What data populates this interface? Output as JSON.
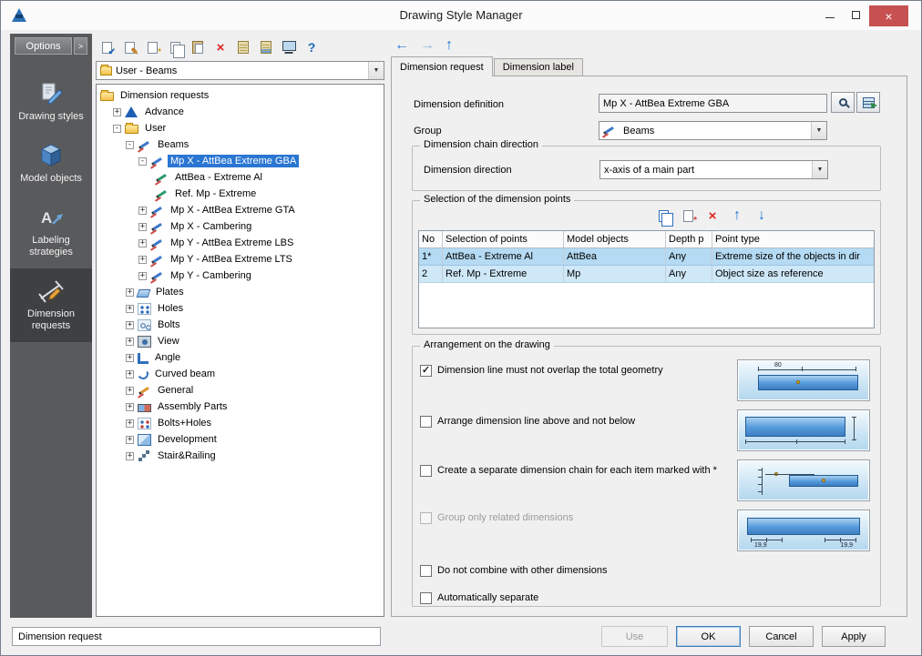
{
  "window": {
    "title": "Drawing Style Manager"
  },
  "colors": {
    "accent_blue": "#2a76d2",
    "sidebar_gray": "#595a5c",
    "row_selected_blue": "#b5daf3",
    "close_red": "#c75050"
  },
  "icons": {
    "close": "×",
    "check": "✔",
    "pencil": "✎",
    "star": "*",
    "cross": "×",
    "back": "←",
    "forward": "→",
    "up": "↑",
    "down": "↓",
    "help": "?",
    "dropdown": "▼",
    "chevron": ">",
    "checkmark": "✓",
    "arrow_small": "▶"
  },
  "sidebar": {
    "options_label": "Options",
    "items": [
      {
        "label": "Drawing styles",
        "selected": false
      },
      {
        "label": "Model objects",
        "selected": false
      },
      {
        "label": "Labeling strategies",
        "selected": false
      },
      {
        "label": "Dimension requests",
        "selected": true
      }
    ]
  },
  "tree": {
    "filter_value": "User - Beams",
    "items": [
      {
        "label": "Dimension requests",
        "depth": 0,
        "exp": ""
      },
      {
        "label": "Advance",
        "depth": 1,
        "exp": "+"
      },
      {
        "label": "User",
        "depth": 1,
        "exp": "-"
      },
      {
        "label": "Beams",
        "depth": 2,
        "exp": "-"
      },
      {
        "label": "Mp X - AttBea Extreme GBA",
        "depth": 3,
        "exp": "-",
        "selected": true
      },
      {
        "label": "AttBea - Extreme Al",
        "depth": 4,
        "exp": ""
      },
      {
        "label": "Ref. Mp - Extreme",
        "depth": 4,
        "exp": ""
      },
      {
        "label": "Mp X - AttBea Extreme GTA",
        "depth": 3,
        "exp": "+"
      },
      {
        "label": "Mp X - Cambering",
        "depth": 3,
        "exp": "+"
      },
      {
        "label": "Mp Y - AttBea Extreme LBS",
        "depth": 3,
        "exp": "+"
      },
      {
        "label": "Mp Y - AttBea Extreme LTS",
        "depth": 3,
        "exp": "+"
      },
      {
        "label": "Mp Y - Cambering",
        "depth": 3,
        "exp": "+"
      },
      {
        "label": "Plates",
        "depth": 2,
        "exp": "+"
      },
      {
        "label": "Holes",
        "depth": 2,
        "exp": "+"
      },
      {
        "label": "Bolts",
        "depth": 2,
        "exp": "+"
      },
      {
        "label": "View",
        "depth": 2,
        "exp": "+"
      },
      {
        "label": "Angle",
        "depth": 2,
        "exp": "+"
      },
      {
        "label": "Curved beam",
        "depth": 2,
        "exp": "+"
      },
      {
        "label": "General",
        "depth": 2,
        "exp": "+"
      },
      {
        "label": "Assembly Parts",
        "depth": 2,
        "exp": "+"
      },
      {
        "label": "Bolts+Holes",
        "depth": 2,
        "exp": "+"
      },
      {
        "label": "Development",
        "depth": 2,
        "exp": "+"
      },
      {
        "label": "Stair&Railing",
        "depth": 2,
        "exp": "+"
      }
    ]
  },
  "tabs": [
    {
      "label": "Dimension request",
      "active": true
    },
    {
      "label": "Dimension label",
      "active": false
    }
  ],
  "panel": {
    "dimension_definition_label": "Dimension definition",
    "dimension_definition_value": "Mp X - AttBea Extreme GBA",
    "group_label": "Group",
    "group_value": "Beams",
    "chain_direction": {
      "title": "Dimension chain direction",
      "direction_label": "Dimension direction",
      "direction_value": "x-axis of a main part"
    },
    "points": {
      "title": "Selection of the dimension points",
      "columns": [
        "No",
        "Selection of points",
        "Model objects",
        "Depth p",
        "Point type"
      ],
      "rows": [
        {
          "no": "1*",
          "selection": "AttBea - Extreme Al",
          "objects": "AttBea",
          "depth": "Any",
          "point_type": "Extreme size of the objects in dir"
        },
        {
          "no": "2",
          "selection": "Ref. Mp - Extreme",
          "objects": "Mp",
          "depth": "Any",
          "point_type": "Object size as reference"
        }
      ]
    },
    "arrangement": {
      "title": "Arrangement on the drawing",
      "options": [
        {
          "label": "Dimension line must not overlap the total geometry",
          "checked": true,
          "disabled": false
        },
        {
          "label": "Arrange dimension line above and not below",
          "checked": false,
          "disabled": false
        },
        {
          "label": "Create a separate dimension chain for each item marked with *",
          "checked": false,
          "disabled": false
        },
        {
          "label": "Group only related dimensions",
          "checked": false,
          "disabled": true
        },
        {
          "label": "Do not combine with other dimensions",
          "checked": false,
          "disabled": false
        },
        {
          "label": "Automatically separate",
          "checked": false,
          "disabled": false
        }
      ],
      "thumbnails": {
        "t1_caption": "80",
        "t4_caption_left": "19,9",
        "t4_caption_right": "19,9"
      }
    }
  },
  "footer": {
    "status": "Dimension request",
    "buttons": [
      {
        "label": "Use",
        "disabled": true
      },
      {
        "label": "OK",
        "disabled": false
      },
      {
        "label": "Cancel",
        "disabled": false
      },
      {
        "label": "Apply",
        "disabled": false
      }
    ]
  }
}
